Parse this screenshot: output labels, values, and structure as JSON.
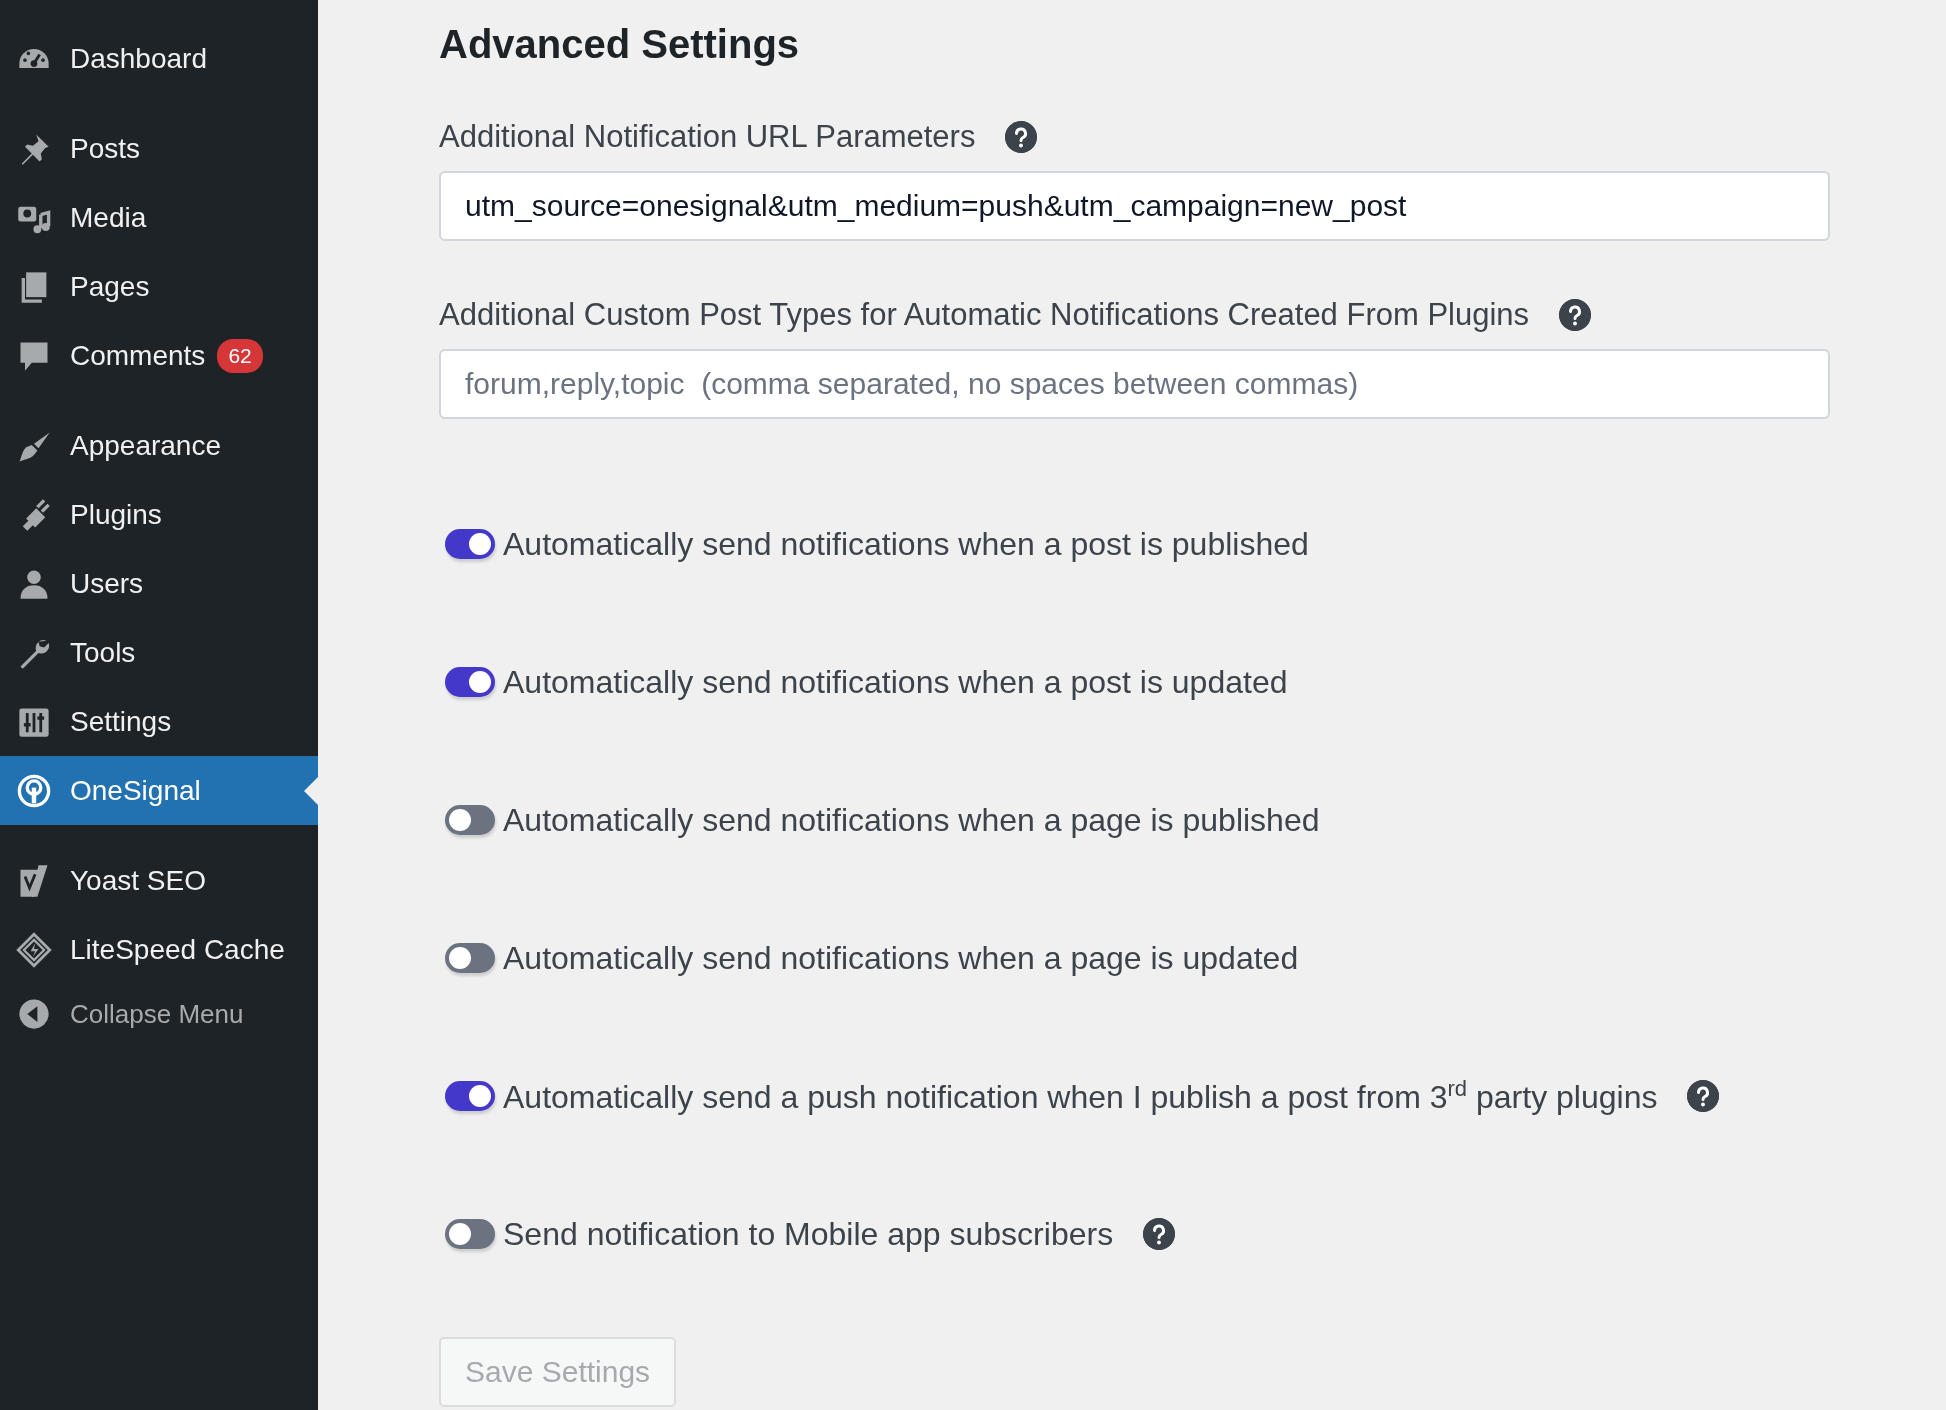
{
  "sidebar": {
    "groups": [
      {
        "items": [
          {
            "label": "Dashboard",
            "selected": false,
            "kind": "item"
          }
        ]
      },
      {
        "items": [
          {
            "label": "Posts",
            "selected": false,
            "kind": "item"
          },
          {
            "label": "Media",
            "selected": false,
            "kind": "item"
          },
          {
            "label": "Pages",
            "selected": false,
            "kind": "item"
          },
          {
            "label": "Comments",
            "selected": false,
            "kind": "item",
            "badge": "62"
          }
        ]
      },
      {
        "items": [
          {
            "label": "Appearance",
            "selected": false,
            "kind": "item"
          },
          {
            "label": "Plugins",
            "selected": false,
            "kind": "item"
          },
          {
            "label": "Users",
            "selected": false,
            "kind": "item"
          },
          {
            "label": "Tools",
            "selected": false,
            "kind": "item"
          },
          {
            "label": "Settings",
            "selected": false,
            "kind": "item"
          },
          {
            "label": "OneSignal",
            "selected": true,
            "kind": "item"
          }
        ]
      },
      {
        "items": [
          {
            "label": "Yoast SEO",
            "selected": false,
            "kind": "item"
          },
          {
            "label": "LiteSpeed Cache",
            "selected": false,
            "kind": "item"
          },
          {
            "label": "Collapse Menu",
            "selected": false,
            "kind": "collapse"
          }
        ]
      }
    ]
  },
  "section": {
    "title": "Advanced Settings",
    "fields": [
      {
        "label": "Additional Notification URL Parameters",
        "help": true,
        "value": "utm_source=onesignal&utm_medium=push&utm_campaign=new_post"
      },
      {
        "label": "Additional Custom Post Types for Automatic Notifications Created From Plugins",
        "help": true,
        "placeholder": "forum,reply,topic  (comma separated, no spaces between commas)"
      }
    ],
    "toggles": [
      {
        "label": "Automatically send notifications when a post is published",
        "on": true,
        "help": false
      },
      {
        "label": "Automatically send notifications when a post is updated",
        "on": true,
        "help": false
      },
      {
        "label": "Automatically send notifications when a page is published",
        "on": false,
        "help": false
      },
      {
        "label": "Automatically send notifications when a page is updated",
        "on": false,
        "help": false
      },
      {
        "label": "Automatically send a push notification when I publish a post from 3$^{rd}$ party plugins",
        "on": true,
        "help": true
      },
      {
        "label": "Send notification to Mobile app subscribers",
        "on": false,
        "help": true
      }
    ],
    "save_button": {
      "label": "Save Settings",
      "disabled": true
    }
  }
}
